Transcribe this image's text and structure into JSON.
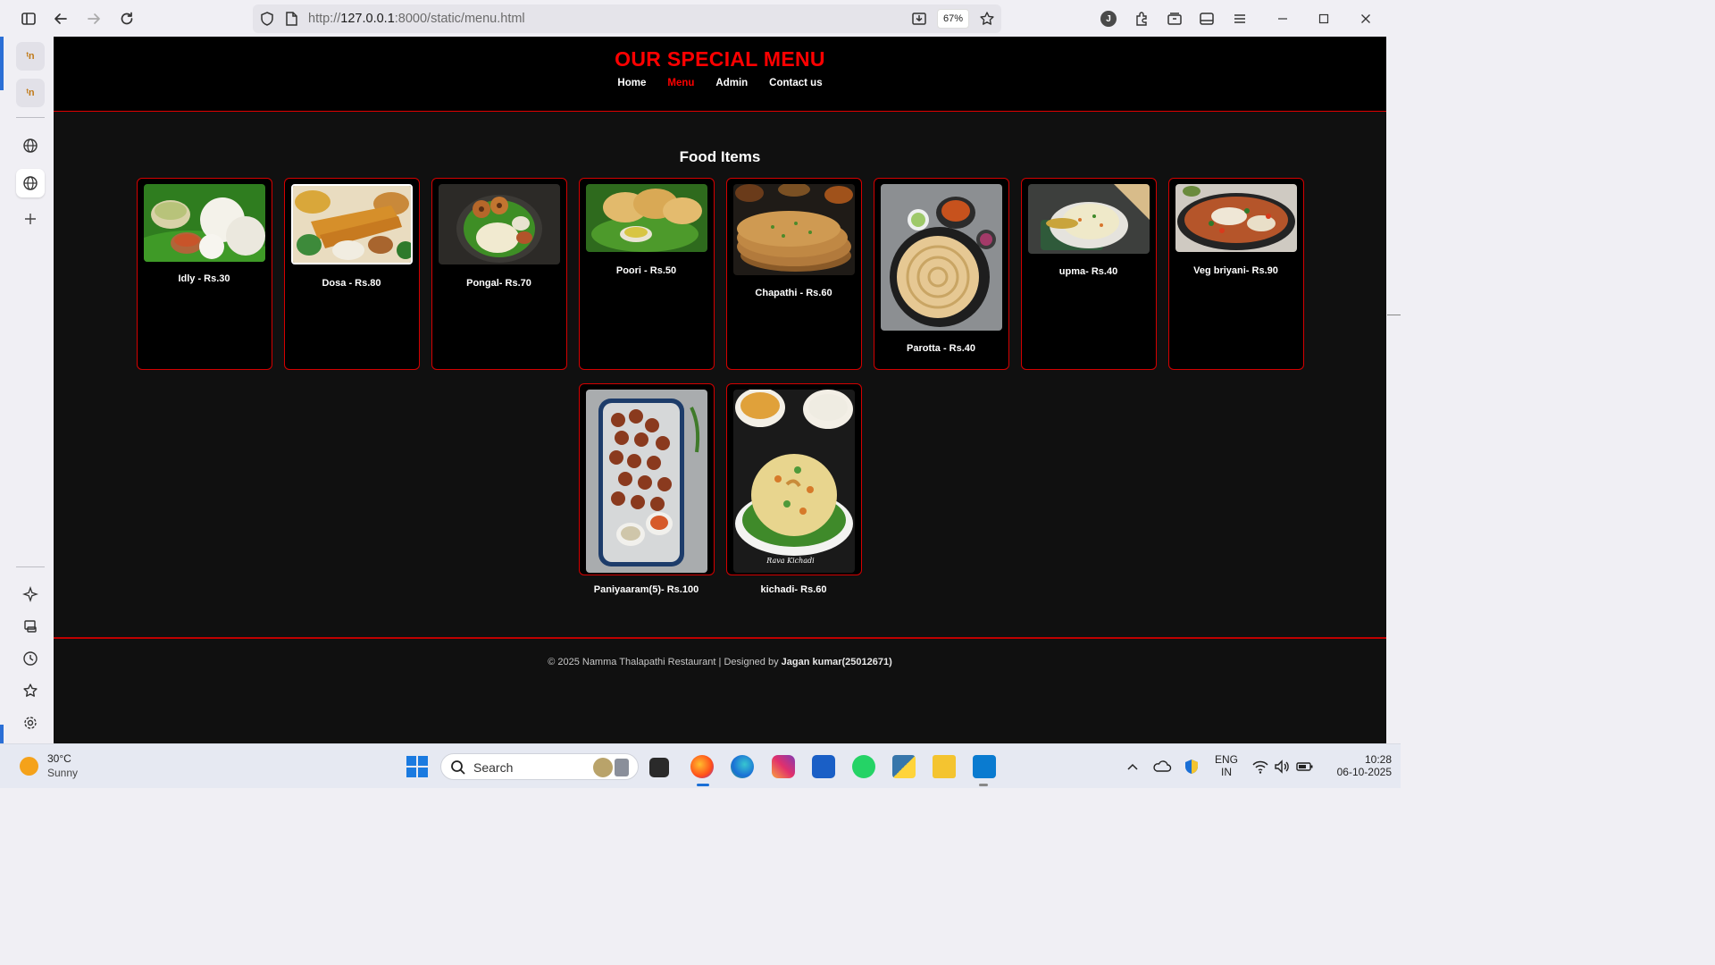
{
  "browser": {
    "url_prefix": "http://",
    "url_host": "127.0.0.1",
    "url_path": ":8000/static/menu.html",
    "zoom": "67%",
    "profile_initial": "J"
  },
  "site": {
    "title": "OUR SPECIAL MENU",
    "nav": [
      {
        "label": "Home",
        "active": false
      },
      {
        "label": "Menu",
        "active": true
      },
      {
        "label": "Admin",
        "active": false
      },
      {
        "label": "Contact us",
        "active": false
      }
    ],
    "section_title": "Food Items",
    "items": [
      {
        "caption": "Idly - Rs.30"
      },
      {
        "caption": "Dosa - Rs.80"
      },
      {
        "caption": "Pongal- Rs.70"
      },
      {
        "caption": "Poori - Rs.50"
      },
      {
        "caption": "Chapathi - Rs.60"
      },
      {
        "caption": "Parotta - Rs.40"
      },
      {
        "caption": "upma- Rs.40"
      },
      {
        "caption": "Veg briyani- Rs.90"
      },
      {
        "caption": "Paniyaaram(5)- Rs.100"
      },
      {
        "caption": "kichadi- Rs.60"
      }
    ],
    "image_watermark": "Rava Kichadi",
    "footer_text": "© 2025 Namma Thalapathi Restaurant | Designed by ",
    "footer_designer": "Jagan kumar(25012671)"
  },
  "taskbar": {
    "temperature": "30°C",
    "condition": "Sunny",
    "search_label": "Search",
    "language": "ENG",
    "region": "IN",
    "time": "10:28",
    "date": "06-10-2025"
  },
  "colors": {
    "accent_red": "#ff0000",
    "card_border": "#d40000",
    "page_bg": "#101010"
  }
}
